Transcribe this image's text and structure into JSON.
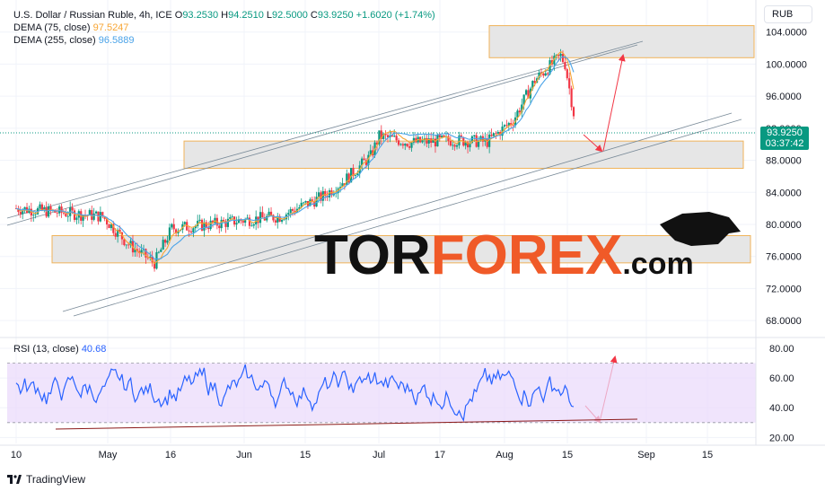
{
  "header": {
    "symbol": "U.S. Dollar / Russian Ruble, 4h, ICE",
    "ohlc": [
      {
        "key": "O",
        "value": "93.2530"
      },
      {
        "key": "H",
        "value": "94.2510"
      },
      {
        "key": "L",
        "value": "92.5000"
      },
      {
        "key": "C",
        "value": "93.9250"
      }
    ],
    "change": "+1.6020 (+1.74%)",
    "dema75_label": "DEMA (75, close)",
    "dema75_value": "97.5247",
    "dema255_label": "DEMA (255, close)",
    "dema255_value": "96.5889",
    "currency": "RUB"
  },
  "price_tag": {
    "price": "93.9250",
    "countdown": "03:37:42"
  },
  "rsi": {
    "label": "RSI (13, close)",
    "value": "40.68"
  },
  "watermark_logo": "TORFOREX.com",
  "branding": "TradingView",
  "colors": {
    "up": "#089981",
    "down": "#f23645",
    "dema75": "#f7a533",
    "dema255": "#4aa3e8",
    "rsi": "#2962ff",
    "rsi_band": "#e9d8fb",
    "zone_fill": "#e6e6e6",
    "zone_border": "#f0b35a",
    "arrow": "#f23645"
  },
  "chart_data": [
    {
      "type": "candlestick",
      "title": "U.S. Dollar / Russian Ruble, 4h, ICE",
      "ylim": [
        66,
        108
      ],
      "y_ticks": [
        "68.0000",
        "72.0000",
        "76.0000",
        "80.0000",
        "84.0000",
        "88.0000",
        "92.0000",
        "96.0000",
        "100.0000",
        "104.0000"
      ],
      "x_ticks": [
        "10",
        "May",
        "16",
        "Jun",
        "15",
        "Jul",
        "17",
        "Aug",
        "15",
        "Sep",
        "15"
      ],
      "close_path": [
        {
          "x": "Apr 10",
          "close": 82.0
        },
        {
          "x": "Apr 20",
          "close": 81.5
        },
        {
          "x": "Apr 30",
          "close": 81.0
        },
        {
          "x": "May 6",
          "close": 77.5
        },
        {
          "x": "May 12",
          "close": 75.2
        },
        {
          "x": "May 16",
          "close": 79.5
        },
        {
          "x": "May 25",
          "close": 80.0
        },
        {
          "x": "Jun 1",
          "close": 80.5
        },
        {
          "x": "Jun 10",
          "close": 81.0
        },
        {
          "x": "Jun 20",
          "close": 83.5
        },
        {
          "x": "Jun 25",
          "close": 85.5
        },
        {
          "x": "Jul 1",
          "close": 88.5
        },
        {
          "x": "Jul 3",
          "close": 91.0
        },
        {
          "x": "Jul 10",
          "close": 90.2
        },
        {
          "x": "Jul 20",
          "close": 90.5
        },
        {
          "x": "Jul 28",
          "close": 90.3
        },
        {
          "x": "Aug 3",
          "close": 93.0
        },
        {
          "x": "Aug 8",
          "close": 98.0
        },
        {
          "x": "Aug 14",
          "close": 101.0
        },
        {
          "x": "Aug 15",
          "close": 100.0
        },
        {
          "x": "Aug 17",
          "close": 93.9
        }
      ],
      "zones": [
        {
          "from": 100.8,
          "to": 104.8
        },
        {
          "from": 87.0,
          "to": 90.4
        },
        {
          "from": 75.2,
          "to": 78.6
        }
      ],
      "series": [
        {
          "name": "DEMA (75, close)",
          "last": 97.5247
        },
        {
          "name": "DEMA (255, close)",
          "last": 96.5889
        }
      ]
    },
    {
      "type": "line",
      "title": "RSI (13, close)",
      "ylim": [
        16,
        86
      ],
      "y_ticks": [
        "20.00",
        "40.00",
        "60.00",
        "80.00"
      ],
      "bands": [
        30,
        70
      ],
      "last": 40.68
    }
  ]
}
